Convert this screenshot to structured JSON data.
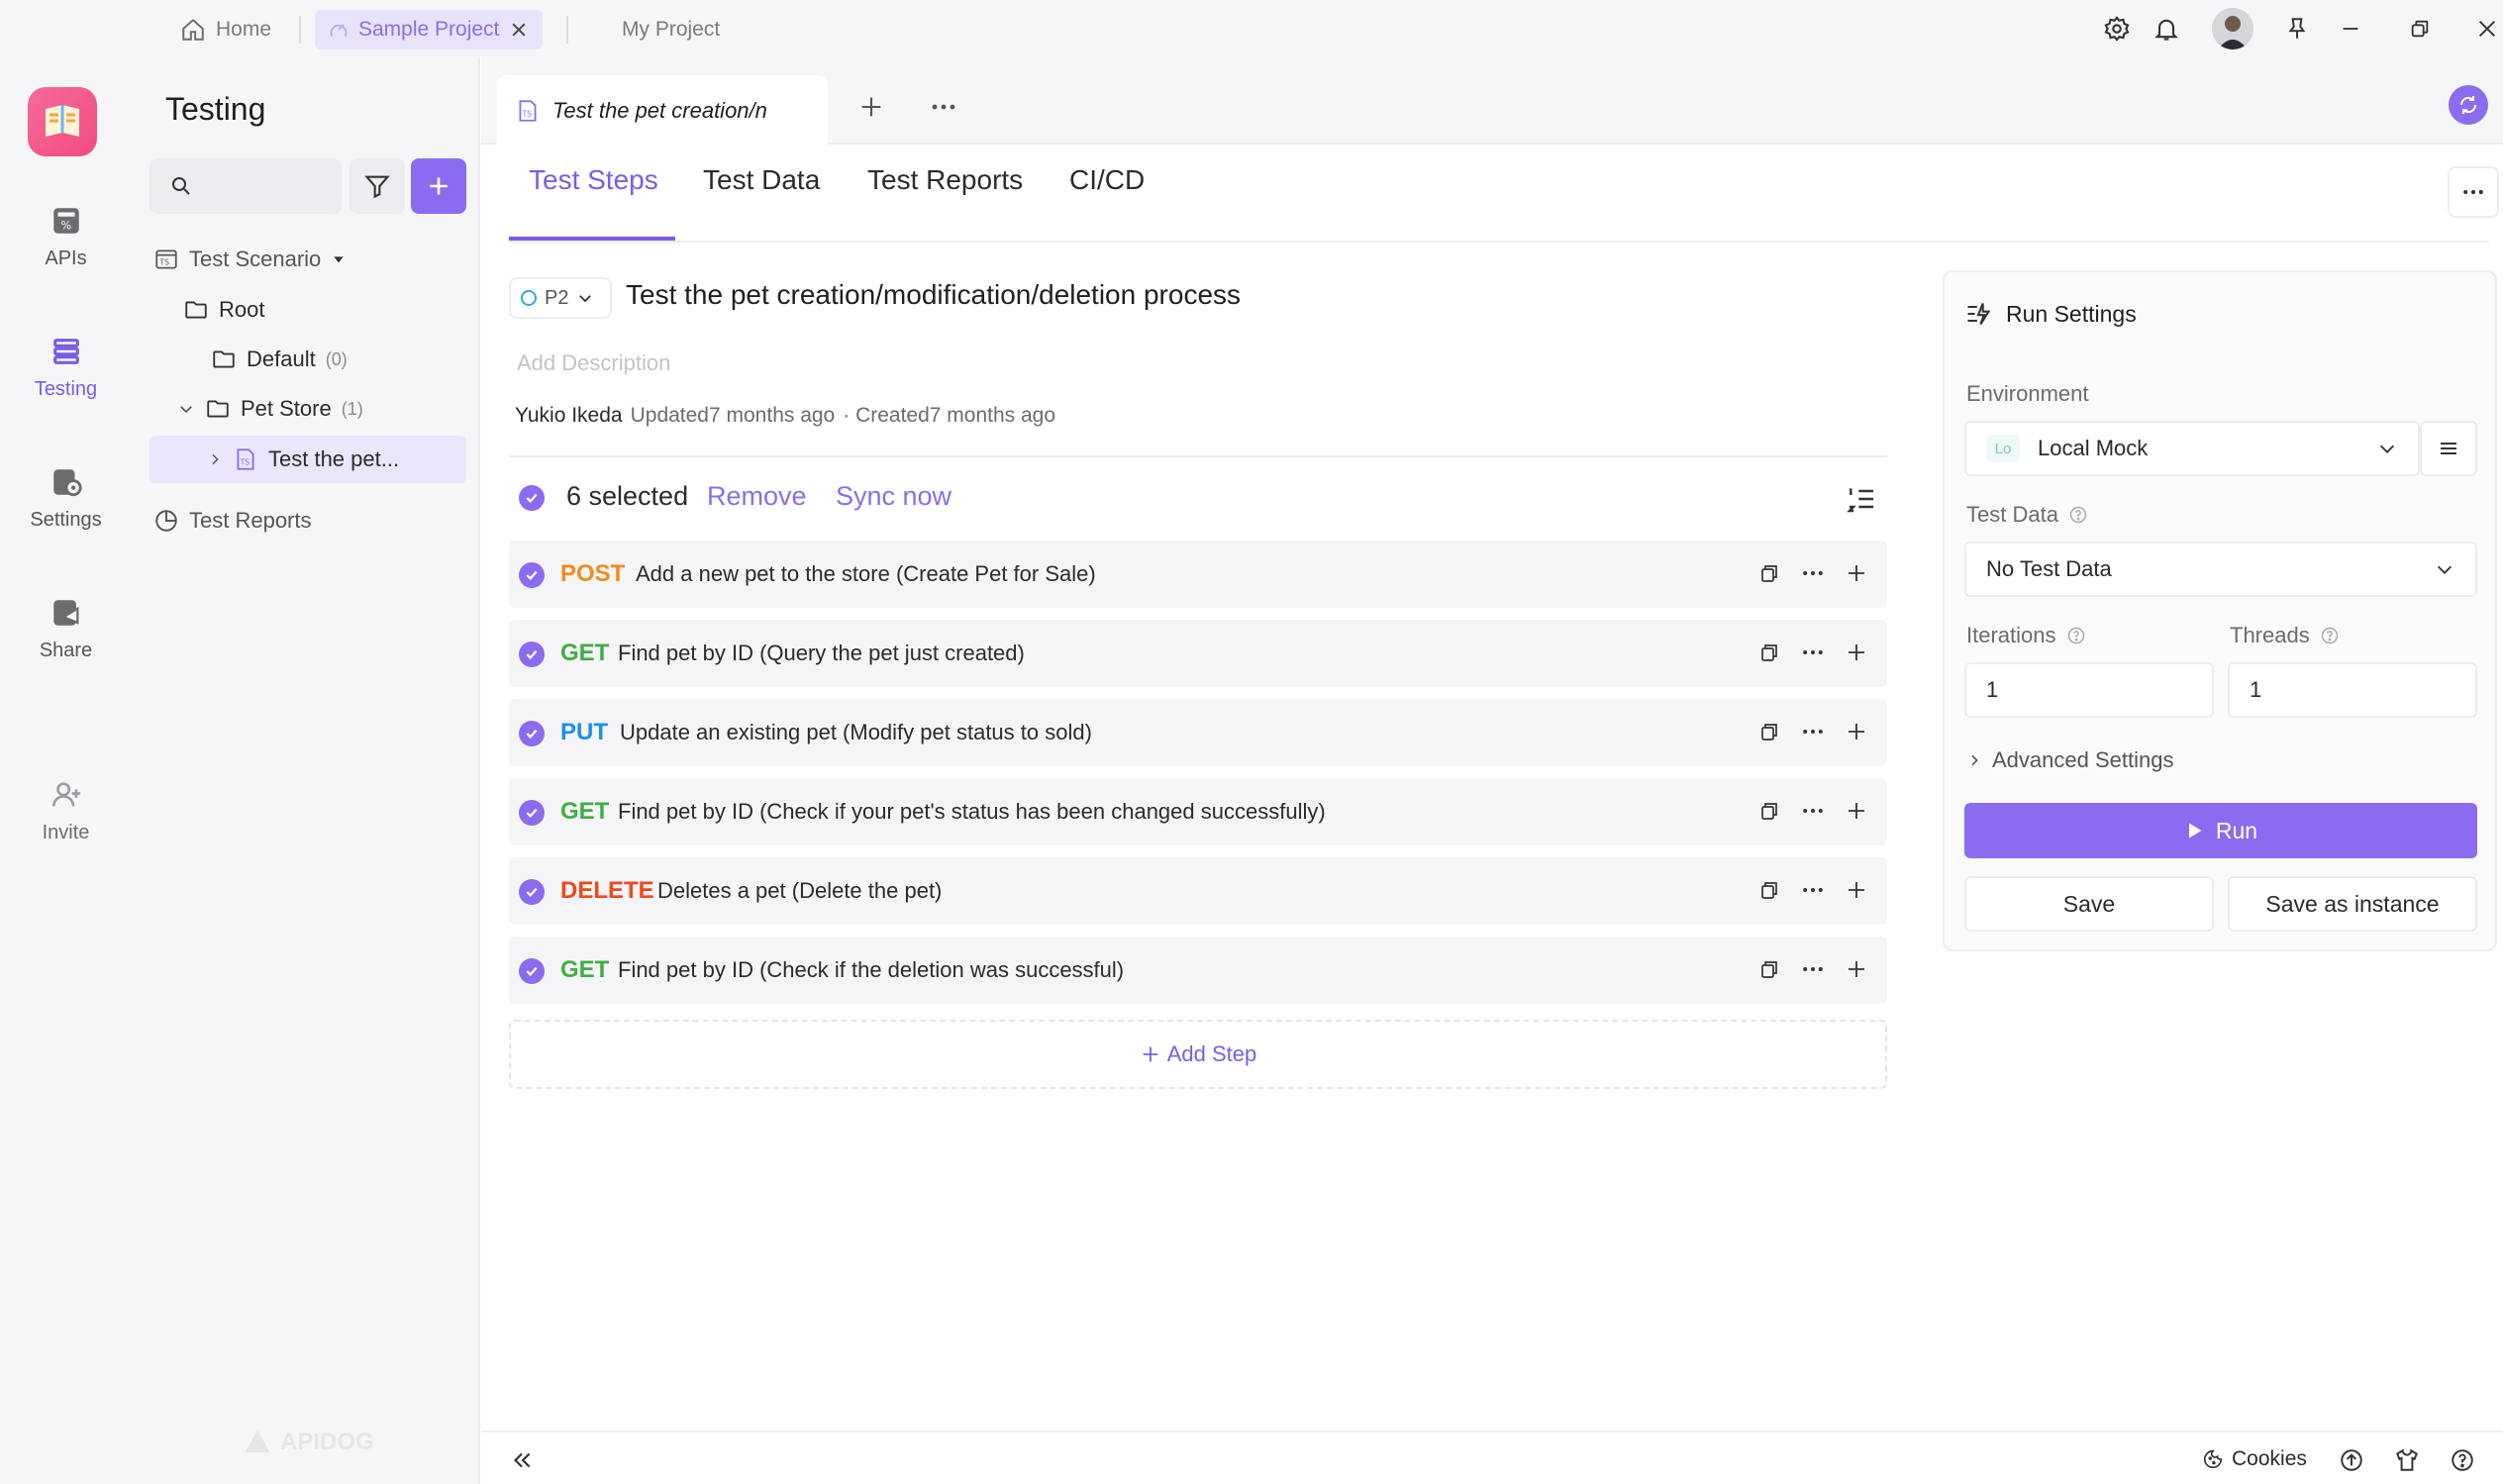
{
  "topbar": {
    "home_label": "Home",
    "active_tab_label": "Sample Project",
    "other_tab_label": "My Project"
  },
  "rail": {
    "items": [
      {
        "label": "APIs"
      },
      {
        "label": "Testing"
      },
      {
        "label": "Settings"
      },
      {
        "label": "Share"
      },
      {
        "label": "Invite"
      }
    ]
  },
  "tree": {
    "title": "Testing",
    "scenario_label": "Test Scenario",
    "root_label": "Root",
    "default_label": "Default",
    "default_count": "(0)",
    "petstore_label": "Pet Store",
    "petstore_count": "(1)",
    "test_item_label": "Test the pet...",
    "reports_label": "Test Reports",
    "watermark": "APIDOG"
  },
  "editor": {
    "file_tab_label": "Test the pet creation/n",
    "subtabs": [
      "Test Steps",
      "Test Data",
      "Test Reports",
      "CI/CD"
    ],
    "priority": "P2",
    "title": "Test the pet creation/modification/deletion process",
    "description_placeholder": "Add Description",
    "author": "Yukio Ikeda",
    "updated": "Updated7 months ago",
    "created": "· Created7 months ago",
    "selected_label": "6 selected",
    "remove_label": "Remove",
    "sync_label": "Sync now",
    "add_step_label": "Add Step",
    "steps": [
      {
        "method": "POST",
        "name": "Add a new pet to the store (Create Pet for Sale)"
      },
      {
        "method": "GET",
        "name": "Find pet by ID (Query the pet just created)"
      },
      {
        "method": "PUT",
        "name": "Update an existing pet (Modify pet status to sold)"
      },
      {
        "method": "GET",
        "name": "Find pet by ID (Check if your pet's status has been changed successfully)"
      },
      {
        "method": "DELETE",
        "name": "Deletes a pet (Delete the pet)"
      },
      {
        "method": "GET",
        "name": "Find pet by ID (Check if the deletion was successful)"
      }
    ]
  },
  "run_settings": {
    "title": "Run Settings",
    "environment_label": "Environment",
    "environment_badge": "Lo",
    "environment_value": "Local Mock",
    "test_data_label": "Test Data",
    "test_data_value": "No Test Data",
    "iterations_label": "Iterations",
    "iterations_value": "1",
    "threads_label": "Threads",
    "threads_value": "1",
    "advanced_label": "Advanced Settings",
    "run_label": "Run",
    "save_label": "Save",
    "save_instance_label": "Save as instance"
  },
  "footer": {
    "cookies_label": "Cookies"
  },
  "colors": {
    "accent": "#7b5ce6",
    "post": "#f08c1a",
    "get": "#3fae45",
    "put": "#1f8cf0",
    "delete": "#f0491a"
  }
}
